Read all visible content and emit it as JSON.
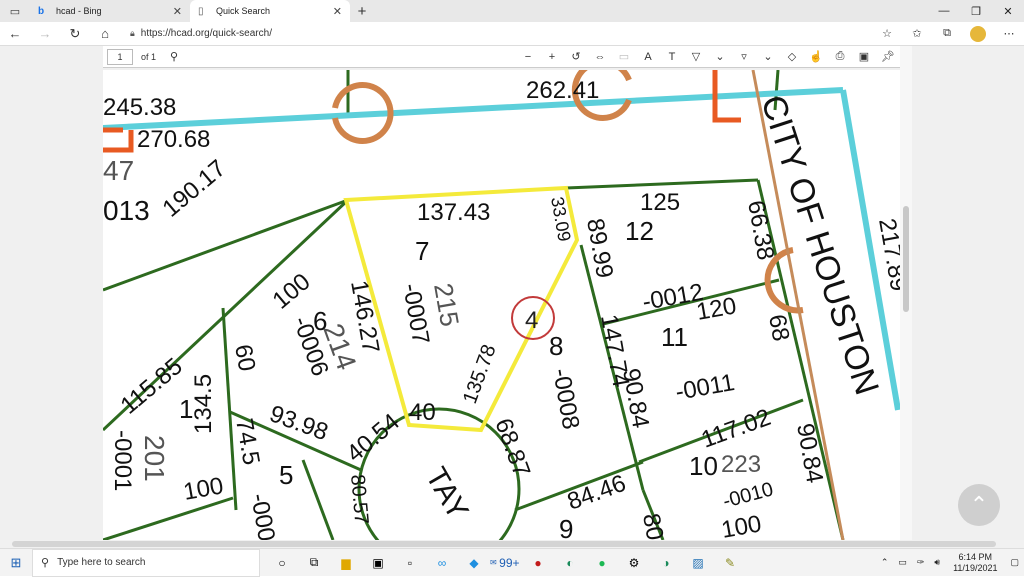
{
  "browser": {
    "tabs": [
      {
        "title": "hcad - Bing",
        "icon": "bing-icon"
      },
      {
        "title": "Quick Search",
        "icon": "page-icon"
      }
    ],
    "url": "https://hcad.org/quick-search/"
  },
  "pdf_toolbar": {
    "page_number": "1",
    "page_total": "of 1"
  },
  "map": {
    "labels": {
      "l245": "245.38",
      "l270": "270.68",
      "l262": "262.41",
      "l47": "47",
      "l013": "013",
      "l190": "190.17",
      "l137": "137.43",
      "l33": "33.09",
      "l125": "125",
      "l66": "66.38",
      "l217": "217.89",
      "lot7": "7",
      "lot12": "12",
      "lot0012": "-0012",
      "l215": "215",
      "l0007": "-0007",
      "l146": "146.27",
      "l100a": "100",
      "lot6": "6",
      "l214": "214",
      "l0006": "-0006",
      "l89": "89.99",
      "circ4": "4",
      "lot8": "8",
      "l135": "135.78",
      "l147": "147.74",
      "l0008": "-0008",
      "l120": "120",
      "lot11": "11",
      "l68": "68",
      "l0011": "-0011",
      "l90a": "90.84",
      "l115": "115.85",
      "l60": "60",
      "lot1": "1",
      "l134": "134.5",
      "l0001": "-0001",
      "l201": "201",
      "l74": "74.5",
      "l93": "93.98",
      "l40": "40",
      "l40b": "40.54",
      "l68b": "68.87",
      "l117": "117.02",
      "l90b": "90.84",
      "lot10": "10",
      "l223": "223",
      "l0010": "-0010",
      "lot5": "5",
      "l100b": "100",
      "l0000": "-000",
      "l80": "80.57",
      "tay": "TAY",
      "l84": "84.46",
      "lot9": "9",
      "l80b": "80",
      "l100c": "100",
      "city": "CITY OF HOUSTON"
    }
  },
  "taskbar": {
    "search_placeholder": "Type here to search",
    "time": "6:14 PM",
    "date": "11/19/2021",
    "mail_badge": "99+"
  }
}
